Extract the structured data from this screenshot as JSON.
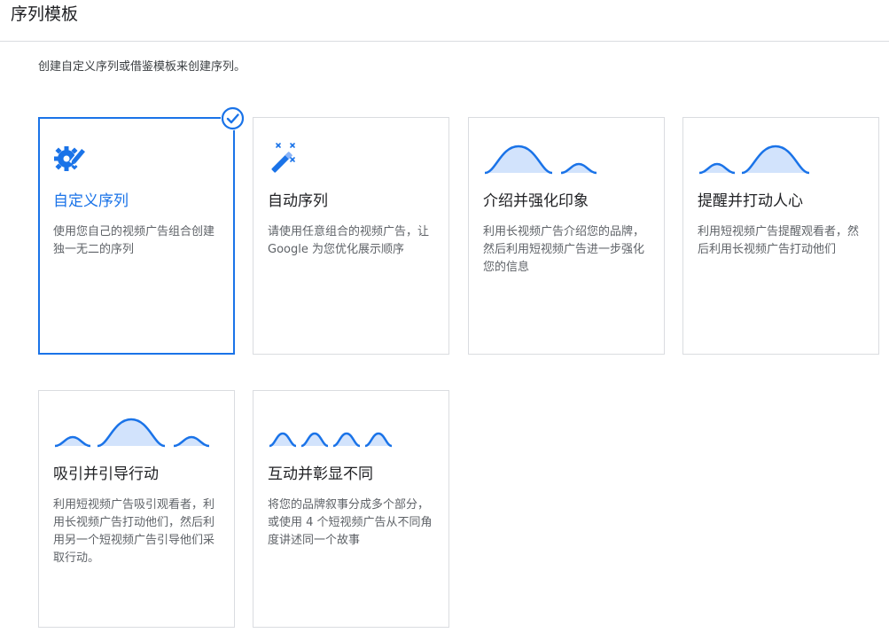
{
  "header": {
    "title": "序列模板"
  },
  "subtitle": "创建自定义序列或借鉴模板来创建序列。",
  "cards": [
    {
      "title": "自定义序列",
      "desc": "使用您自己的视频广告组合创建独一无二的序列",
      "icon": "gear-pencil-icon",
      "selected": true
    },
    {
      "title": "自动序列",
      "desc": "请使用任意组合的视频广告，让 Google 为您优化展示顺序",
      "icon": "magic-wand-icon",
      "selected": false
    },
    {
      "title": "介绍并强化印象",
      "desc": "利用长视频广告介绍您的品牌，然后利用短视频广告进一步强化您的信息",
      "icon": "wave-long-short-icon",
      "selected": false
    },
    {
      "title": "提醒并打动人心",
      "desc": "利用短视频广告提醒观看者，然后利用长视频广告打动他们",
      "icon": "wave-short-long-icon",
      "selected": false
    },
    {
      "title": "吸引并引导行动",
      "desc": "利用短视频广告吸引观看者，利用长视频广告打动他们，然后利用另一个短视频广告引导他们采取行动。",
      "icon": "wave-short-long-short-icon",
      "selected": false
    },
    {
      "title": "互动并彰显不同",
      "desc": "将您的品牌叙事分成多个部分，或使用 4 个短视频广告从不同角度讲述同一个故事",
      "icon": "wave-four-short-icon",
      "selected": false
    }
  ],
  "colors": {
    "accent": "#1a73e8",
    "wave_fill": "#d2e3fc",
    "border": "#dadce0"
  }
}
